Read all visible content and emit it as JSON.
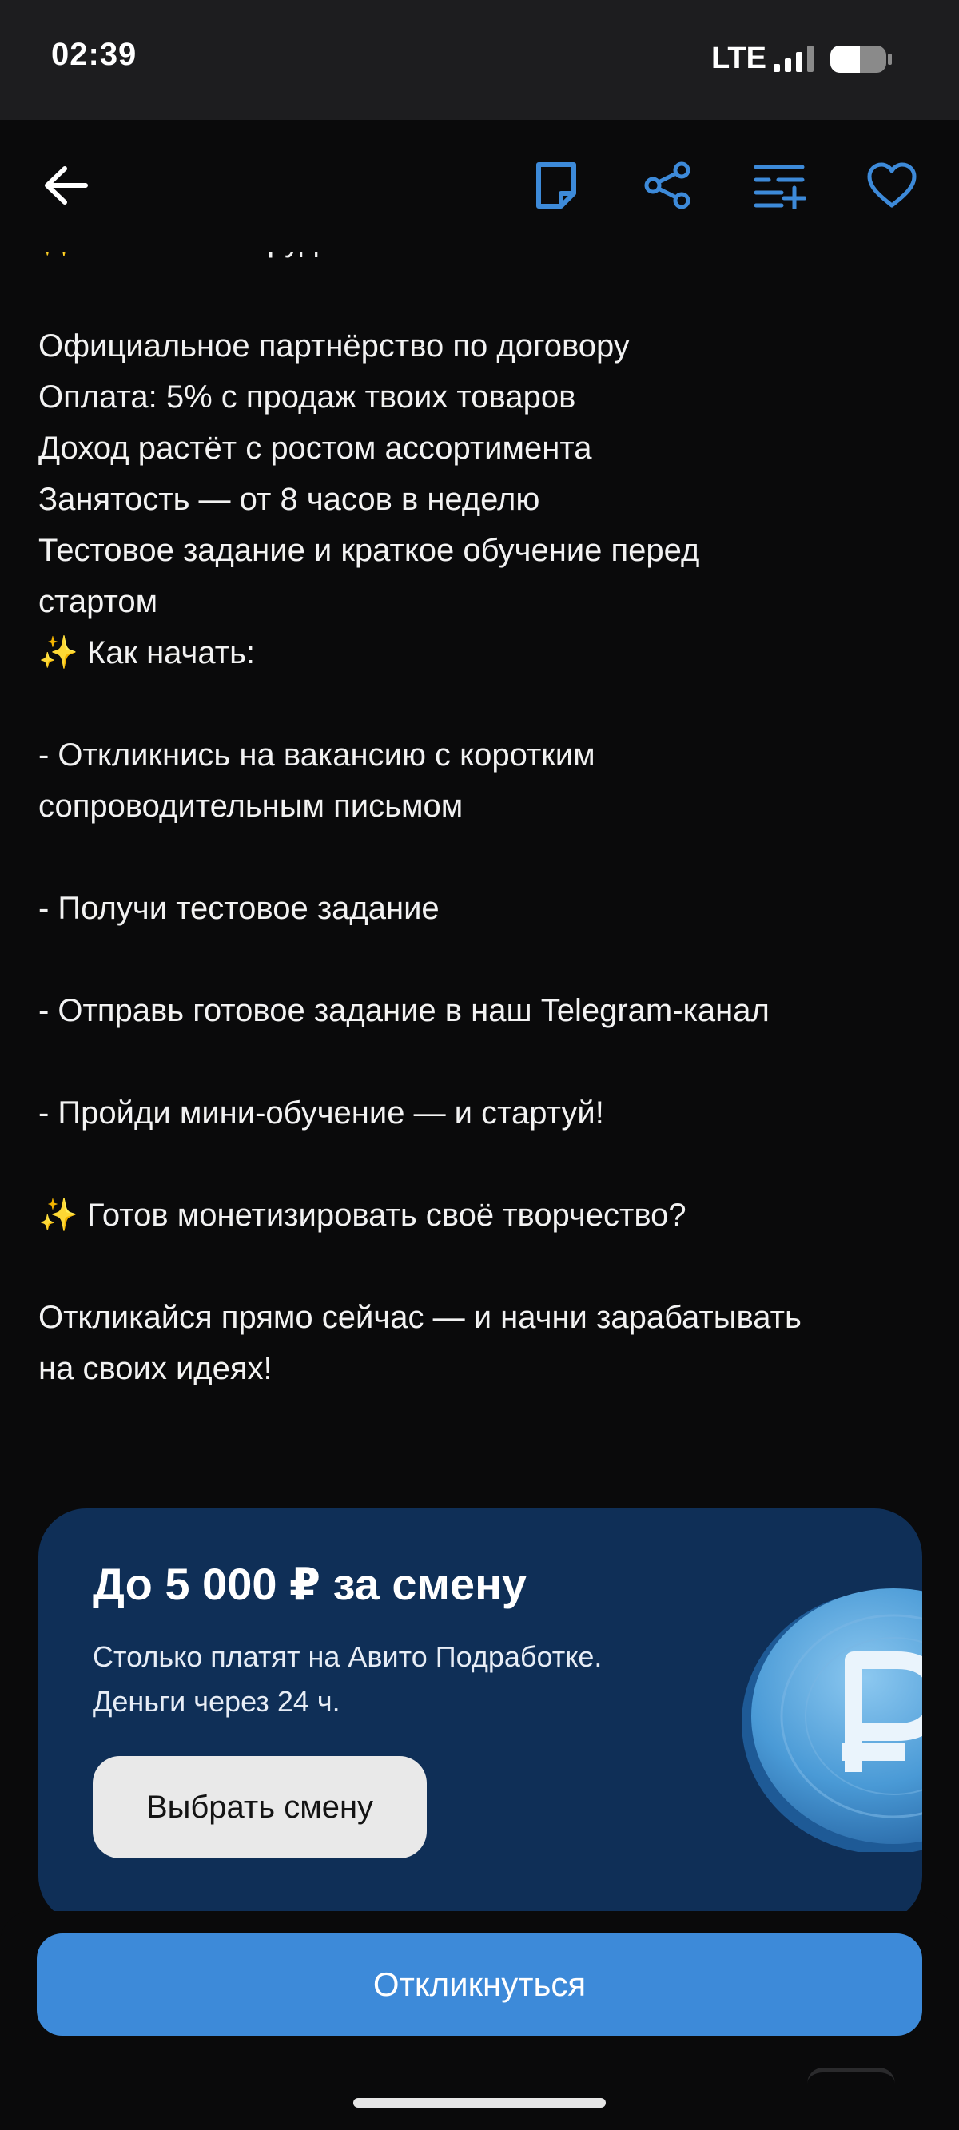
{
  "status_bar": {
    "time": "02:39",
    "network": "LTE"
  },
  "app_bar": {
    "icons": [
      "back-arrow-icon",
      "note-icon",
      "share-icon",
      "list-add-icon",
      "heart-icon"
    ],
    "accent_color": "#3d8ad9"
  },
  "description": {
    "cut_heading": "✨ Условия сотрудничества",
    "block1": [
      "Официальное партнёрство по договору",
      "Оплата: 5% с продаж твоих товаров",
      "Доход растёт с ростом ассортимента",
      "Занятость — от 8 часов в неделю",
      "Тестовое задание и краткое обучение перед",
      "стартом",
      "✨ Как начать:"
    ],
    "step1": [
      "- Откликнись на вакансию с коротким",
      "сопроводительным письмом"
    ],
    "step2": "- Получи тестовое задание",
    "step3": "- Отправь готовое задание в наш Telegram-канал",
    "step4": "- Пройди мини-обучение — и стартуй!",
    "cta_question": "✨ Готов монетизировать своё творчество?",
    "closing": [
      "Откликайся прямо сейчас — и начни зарабатывать",
      "на своих идеях!"
    ]
  },
  "promo": {
    "title": "До 5 000 ₽ за смену",
    "subtitle_line1": "Столько платят на Авито Подработке.",
    "subtitle_line2": "Деньги через 24 ч.",
    "button_label": "Выбрать смену",
    "background_color": "#0f2f57",
    "coin_icon": "ruble-coin-icon"
  },
  "bottom": {
    "respond_label": "Откликнуться"
  }
}
